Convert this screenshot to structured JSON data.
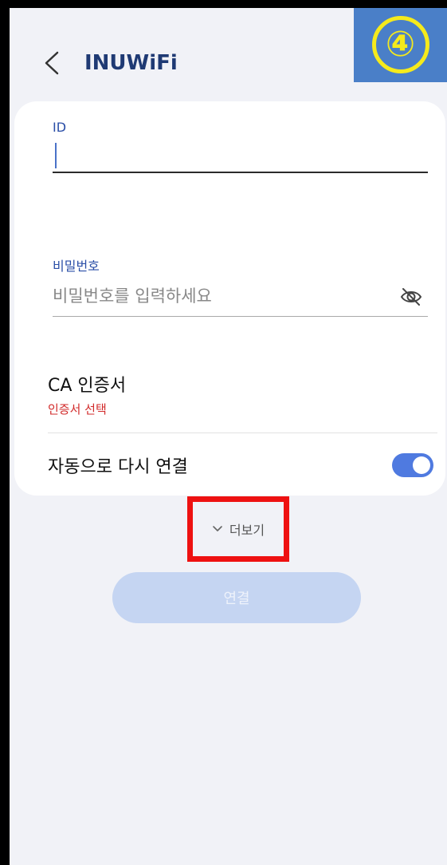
{
  "header": {
    "title": "INUWiFi",
    "back_icon": "chevron-left-icon"
  },
  "badge": {
    "text": "④",
    "bg_color": "#4a7fc8",
    "color": "#f5ea1c"
  },
  "form": {
    "id_label": "ID",
    "id_value": "",
    "password_label": "비밀번호",
    "password_placeholder": "비밀번호를 입력하세요",
    "password_toggle_icon": "eye-off-icon",
    "ca_title": "CA 인증서",
    "ca_value": "인증서 선택",
    "auto_reconnect_label": "자동으로 다시 연결",
    "auto_reconnect_on": true
  },
  "more": {
    "label": "더보기",
    "icon": "chevron-down-icon",
    "highlight_color": "#ee1111"
  },
  "connect_button": {
    "label": "연결",
    "enabled": false
  },
  "colors": {
    "accent": "#2a4ea7",
    "error": "#d22b2b",
    "toggle": "#4f7ae0",
    "background": "#f1f2f7"
  }
}
